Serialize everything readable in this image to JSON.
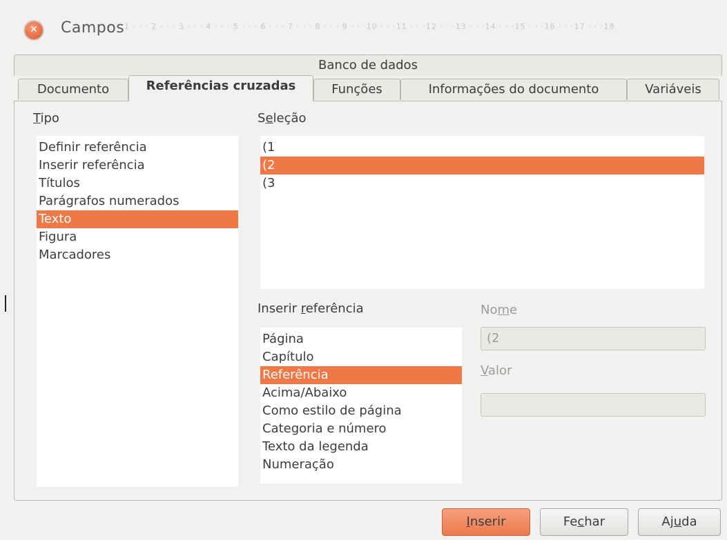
{
  "window": {
    "title": "Campos",
    "ruler": "1 · · · 2 · · · 3 · · · 4 · · · 5 · · · 6 · · · 7 · · · 8 · · · 9 · · ·10 · · ·11 · · ·12 · · ·13 · · ·14 · · ·15 · · ·16 · · ·17 · · ·18"
  },
  "tabs": {
    "top_row": [
      "Banco de dados"
    ],
    "bottom_row": [
      "Documento",
      "Referências cruzadas",
      "Funções",
      "Informações do documento",
      "Variáveis"
    ],
    "active": "Referências cruzadas"
  },
  "tipo": {
    "label": "Tipo",
    "items": [
      "Definir referência",
      "Inserir referência",
      "Títulos",
      "Parágrafos numerados",
      "Texto",
      "Figura",
      "Marcadores"
    ],
    "selected": "Texto"
  },
  "selecao": {
    "label": "Seleção",
    "items": [
      "(1",
      "(2",
      "(3"
    ],
    "selected": "(2"
  },
  "inserir_referencia": {
    "label": "Inserir referência",
    "items": [
      "Página",
      "Capítulo",
      "Referência",
      "Acima/Abaixo",
      "Como estilo de página",
      "Categoria e número",
      "Texto da legenda",
      "Numeração"
    ],
    "selected": "Referência"
  },
  "nome": {
    "label": "Nome",
    "value": "(2"
  },
  "valor": {
    "label": "Valor",
    "value": ""
  },
  "buttons": {
    "inserir": "Inserir",
    "fechar": "Fechar",
    "ajuda": "Ajuda"
  },
  "colors": {
    "selection": "#f07746",
    "background": "#f2f1f0"
  },
  "icons": {
    "close": "close-icon"
  }
}
